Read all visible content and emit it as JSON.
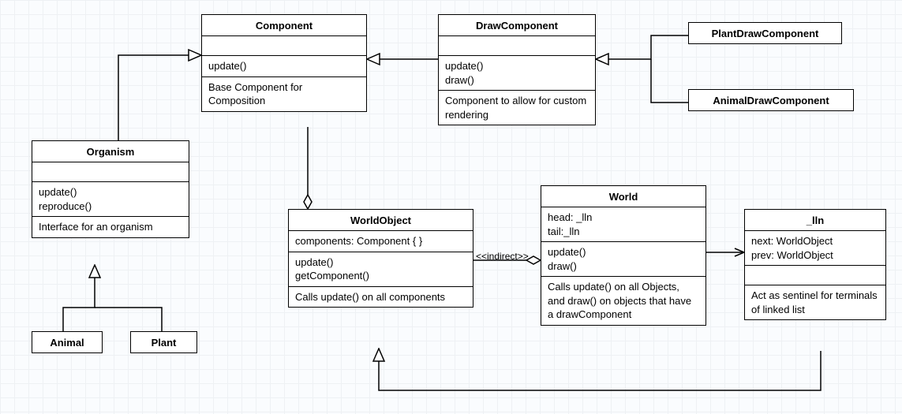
{
  "diagramType": "UML Class Diagram",
  "classes": {
    "component": {
      "name": "Component",
      "methods": "update()",
      "note": "Base Component for Composition"
    },
    "drawComponent": {
      "name": "DrawComponent",
      "methods": "update()\ndraw()",
      "note": "Component to allow for custom rendering"
    },
    "plantDrawComponent": {
      "name": "PlantDrawComponent"
    },
    "animalDrawComponent": {
      "name": "AnimalDrawComponent"
    },
    "organism": {
      "name": "Organism",
      "methods": "update()\nreproduce()",
      "note": "Interface for an organism"
    },
    "worldObject": {
      "name": "WorldObject",
      "attrs": "components: Component { }",
      "methods": "update()\ngetComponent()",
      "note": "Calls update() on all components"
    },
    "world": {
      "name": "World",
      "attrs": "head: _lln\ntail:_lln",
      "methods": "update()\ndraw()",
      "note": "Calls update() on all Objects, and draw() on objects that have a drawComponent"
    },
    "lln": {
      "name": "_lln",
      "attrs": "next: WorldObject\nprev: WorldObject",
      "note": "Act as sentinel for terminals of linked list"
    },
    "animal": {
      "name": "Animal"
    },
    "plant": {
      "name": "Plant"
    }
  },
  "edgeLabels": {
    "indirect": "<<indirect>>"
  },
  "relations": [
    {
      "from": "Organism",
      "to": "Component",
      "type": "inherits"
    },
    {
      "from": "DrawComponent",
      "to": "Component",
      "type": "inherits"
    },
    {
      "from": "PlantDrawComponent",
      "to": "DrawComponent",
      "type": "inherits"
    },
    {
      "from": "AnimalDrawComponent",
      "to": "DrawComponent",
      "type": "inherits"
    },
    {
      "from": "Animal",
      "to": "Organism",
      "type": "inherits"
    },
    {
      "from": "Plant",
      "to": "Organism",
      "type": "inherits"
    },
    {
      "from": "WorldObject",
      "to": "Component",
      "type": "aggregation"
    },
    {
      "from": "World",
      "to": "WorldObject",
      "type": "aggregation",
      "label": "<<indirect>>"
    },
    {
      "from": "World",
      "to": "_lln",
      "type": "association"
    },
    {
      "from": "_lln",
      "to": "WorldObject",
      "type": "inherits"
    }
  ]
}
